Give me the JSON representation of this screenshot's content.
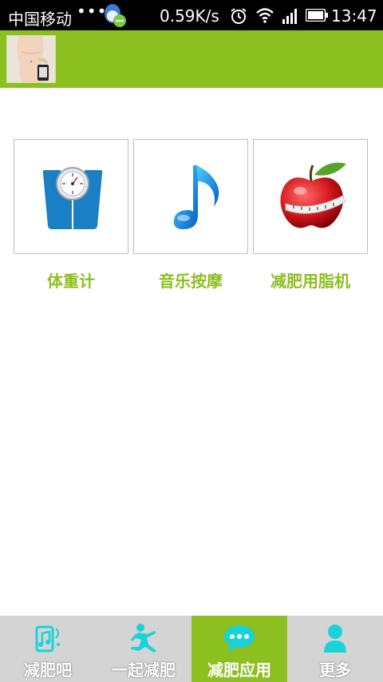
{
  "status_bar": {
    "carrier": "中国移动",
    "dots": "•••",
    "speed": "0.59K/s",
    "time": "13:47"
  },
  "apps": [
    {
      "label": "体重计",
      "icon": "scale-icon"
    },
    {
      "label": "音乐按摩",
      "icon": "music-note-icon"
    },
    {
      "label": "减肥用脂机",
      "icon": "apple-tape-icon"
    }
  ],
  "bottom_nav": [
    {
      "label": "减肥吧",
      "icon": "music-phone-icon",
      "active": false
    },
    {
      "label": "一起减肥",
      "icon": "running-person-icon",
      "active": false
    },
    {
      "label": "减肥应用",
      "icon": "chat-bubble-icon",
      "active": true
    },
    {
      "label": "更多",
      "icon": "person-icon",
      "active": false
    }
  ],
  "colors": {
    "accent": "#8cbf20",
    "nav_background": "#d4d4d4",
    "icon_cyan": "#19d3d8"
  }
}
